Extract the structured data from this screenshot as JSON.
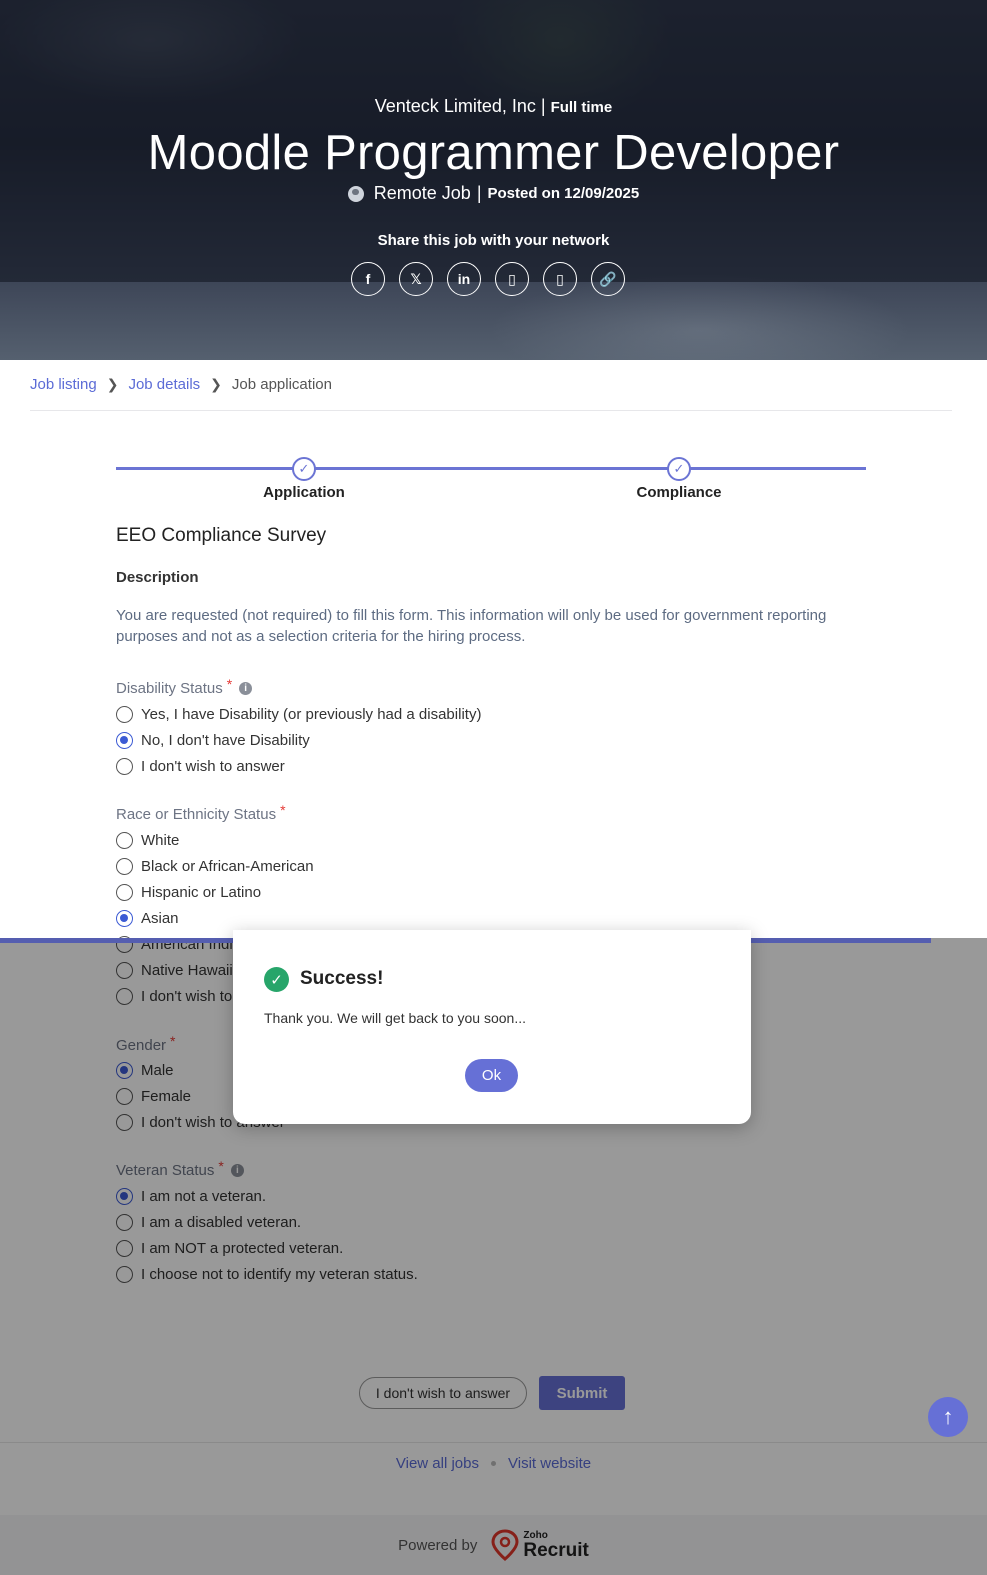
{
  "hero": {
    "company": "Venteck Limited, Inc",
    "job_type": "Full time",
    "title": "Moodle Programmer Developer",
    "location": "Remote Job",
    "posted": "Posted on 12/09/2025",
    "share_text": "Share this job with your network",
    "social": [
      {
        "icon": "facebook-icon",
        "glyph": "f"
      },
      {
        "icon": "x-icon",
        "glyph": "𝕏"
      },
      {
        "icon": "linkedin-icon",
        "glyph": "in"
      },
      {
        "icon": "share-icon-1",
        "glyph": "▯"
      },
      {
        "icon": "share-icon-2",
        "glyph": "▯"
      },
      {
        "icon": "link-icon",
        "glyph": "🔗"
      }
    ]
  },
  "breadcrumb": {
    "item1": "Job listing",
    "item2": "Job details",
    "item3": "Job application"
  },
  "steps": {
    "step1": "Application",
    "step2": "Compliance"
  },
  "form": {
    "heading": "EEO Compliance Survey",
    "description_heading": "Description",
    "description": "You are requested (not required) to fill this form. This information will only be used for government reporting purposes and not as a selection criteria for the hiring process.",
    "disability": {
      "label": "Disability Status",
      "options": [
        "Yes, I have Disability (or previously had a disability)",
        "No, I don't have Disability",
        "I don't wish to answer"
      ],
      "selected": 1
    },
    "race": {
      "label": "Race or Ethnicity Status",
      "options": [
        "White",
        "Black or African-American",
        "Hispanic or Latino",
        "Asian",
        "American Indi",
        "Native Hawaii",
        "I don't wish to"
      ],
      "selected": 3
    },
    "gender": {
      "label": "Gender",
      "options": [
        "Male",
        "Female",
        "I don't wish to answer"
      ],
      "selected": 0
    },
    "veteran": {
      "label": "Veteran Status",
      "options": [
        "I am not a veteran.",
        "I am a disabled veteran.",
        "I am NOT a protected veteran.",
        "I choose not to identify my veteran status."
      ],
      "selected": 0
    },
    "btn_nowish": "I don't wish to answer",
    "btn_submit": "Submit"
  },
  "footer": {
    "view_all": "View all jobs",
    "visit": "Visit website",
    "powered": "Powered by",
    "brand_small": "Zoho",
    "brand": "Recruit"
  },
  "modal": {
    "title": "Success!",
    "message": "Thank you. We will get back to you soon...",
    "ok": "Ok"
  },
  "colors": {
    "accent": "#6670d6",
    "link": "#5b6bd6",
    "success": "#27a56a",
    "required": "#e53935"
  }
}
